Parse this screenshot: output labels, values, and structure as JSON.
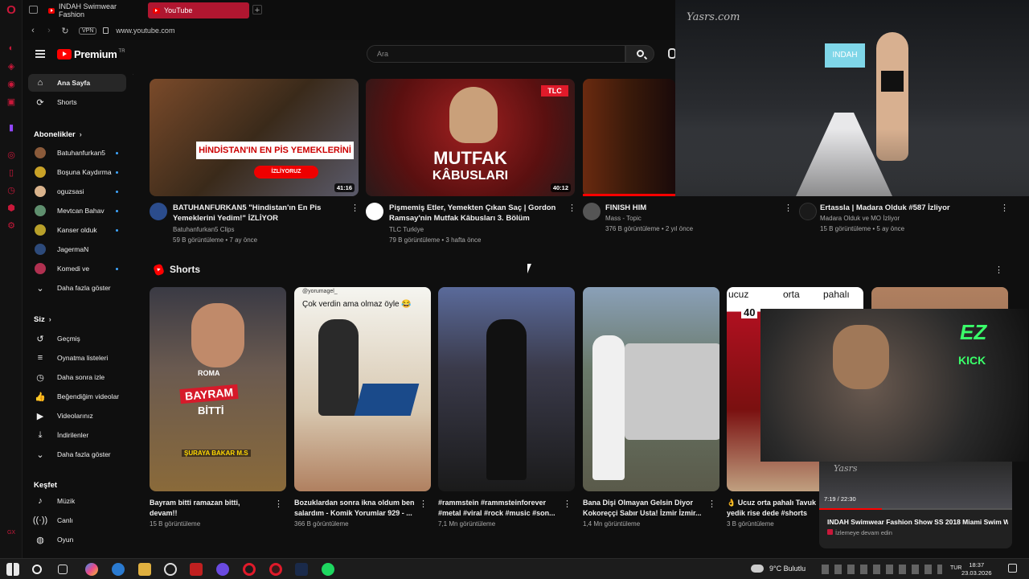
{
  "browser": {
    "tabs": [
      {
        "label": "INDAH Swimwear Fashion"
      },
      {
        "label": "YouTube"
      }
    ],
    "vpn_badge": "VPN",
    "url": "www.youtube.com"
  },
  "header": {
    "logo_text": "Premium",
    "logo_region": "TR",
    "search_placeholder": "Ara"
  },
  "guide": {
    "home": "Ana Sayfa",
    "shorts": "Shorts",
    "subscriptions_head": "Abonelikler",
    "subscriptions": [
      {
        "name": "Batuhanfurkan5",
        "color": "#8a5a3a"
      },
      {
        "name": "Boşuna Kaydırma",
        "color": "#c9a227"
      },
      {
        "name": "oguzsasi",
        "color": "#d9b38c"
      },
      {
        "name": "Mevtcan Bahav",
        "color": "#5f8f6e"
      },
      {
        "name": "Kanser olduk",
        "color": "#b8a02a"
      },
      {
        "name": "JagermaN",
        "color": "#2d4a7a"
      },
      {
        "name": "Komedi ve",
        "color": "#b03050"
      }
    ],
    "show_more": "Daha fazla göster",
    "you_head": "Siz",
    "you_items": [
      "Geçmiş",
      "Oynatma listeleri",
      "Daha sonra izle",
      "Beğendiğim videolar",
      "Videolarınız",
      "İndirilenler",
      "Daha fazla göster"
    ],
    "explore_head": "Keşfet",
    "explore_items": [
      "Müzik",
      "Canlı",
      "Oyun"
    ]
  },
  "videos": [
    {
      "title1": "BATUHANFURKAN5 \"Hindistan'ın En Pis",
      "title2": "Yemeklerini Yedim!\" İZLİYOR",
      "channel": "Batuhanfurkan5 Clips",
      "meta": "59 B görüntüleme • 7 ay önce",
      "duration": "41:16",
      "thumb_caption": "HİNDİSTAN'IN EN PİS YEMEKLERİNİ",
      "thumb_caption2": "İZLİYORUZ"
    },
    {
      "title1": "Pişmemiş Etler, Yemekten Çıkan Saç | Gordon",
      "title2": "Ramsay'nin Mutfak Kâbusları 3. Bölüm",
      "channel": "TLC Turkiye",
      "meta": "79 B görüntüleme • 3 hafta önce",
      "duration": "40:12",
      "thumb_caption": "MUTFAK",
      "thumb_caption2": "KÂBUSLARI",
      "badge": "TLC"
    },
    {
      "title1": "FINISH HIM",
      "title2": "",
      "channel": "Mass - Topic",
      "meta": "376 B görüntüleme • 2 yıl önce"
    },
    {
      "title1": "Ertassla | Madara Olduk #587 İzliyor",
      "title2": "",
      "channel": "Madara Olduk ve MO İzliyor",
      "meta": "15 B görüntüleme • 5 ay önce"
    }
  ],
  "shorts_head": "Shorts",
  "shorts": [
    {
      "title1": "Bayram bitti ramazan bitti,",
      "title2": "devam!!",
      "meta": "15 B görüntüleme",
      "cap1": "BAYRAM",
      "cap2": "BİTTİ",
      "cap3": "ROMA",
      "cap4": "ŞURAYA BAKAR M.S"
    },
    {
      "title1": "Bozuklardan sonra ikna oldum ben",
      "title2": "salardım - Komik Yorumlar 929 - ...",
      "meta": "366 B görüntüleme",
      "cap1": "Çok verdin ama olmaz öyle 😂",
      "cap2": "@yorumagel_"
    },
    {
      "title1": "#rammstein #rammsteinforever",
      "title2": "#metal #viral #rock #music #son...",
      "meta": "7,1 Mn görüntüleme"
    },
    {
      "title1": "Bana Dişi Olmayan Gelsin Diyor",
      "title2": "Kokoreççi Sabır Usta! İzmir İzmir...",
      "meta": "1,4 Mn görüntüleme"
    },
    {
      "title1": "👌 Ucuz orta pahalı Tavuk",
      "title2": "yedik rise dede #shorts",
      "meta": "3 B görüntüleme",
      "cap1": "ucuz",
      "cap2": "orta",
      "cap3": "pahalı",
      "cap4": "40"
    }
  ],
  "overlays": {
    "pip_watermark": "Yasrs.com",
    "pip_banner": "INDAH",
    "cam_brand": "EZ",
    "cam_kick": "KICK",
    "mini_time": "7:19 / 22:30",
    "mini_watermark": "Yasrs",
    "mini_title": "INDAH Swimwear Fashion Show SS 2018 Miami Swim W...",
    "mini_sub": "İzlemeye devam edin"
  },
  "taskbar": {
    "weather": "9°C  Bulutlu",
    "lang": "TUR",
    "time": "18:37",
    "date": "23.03.2026"
  }
}
